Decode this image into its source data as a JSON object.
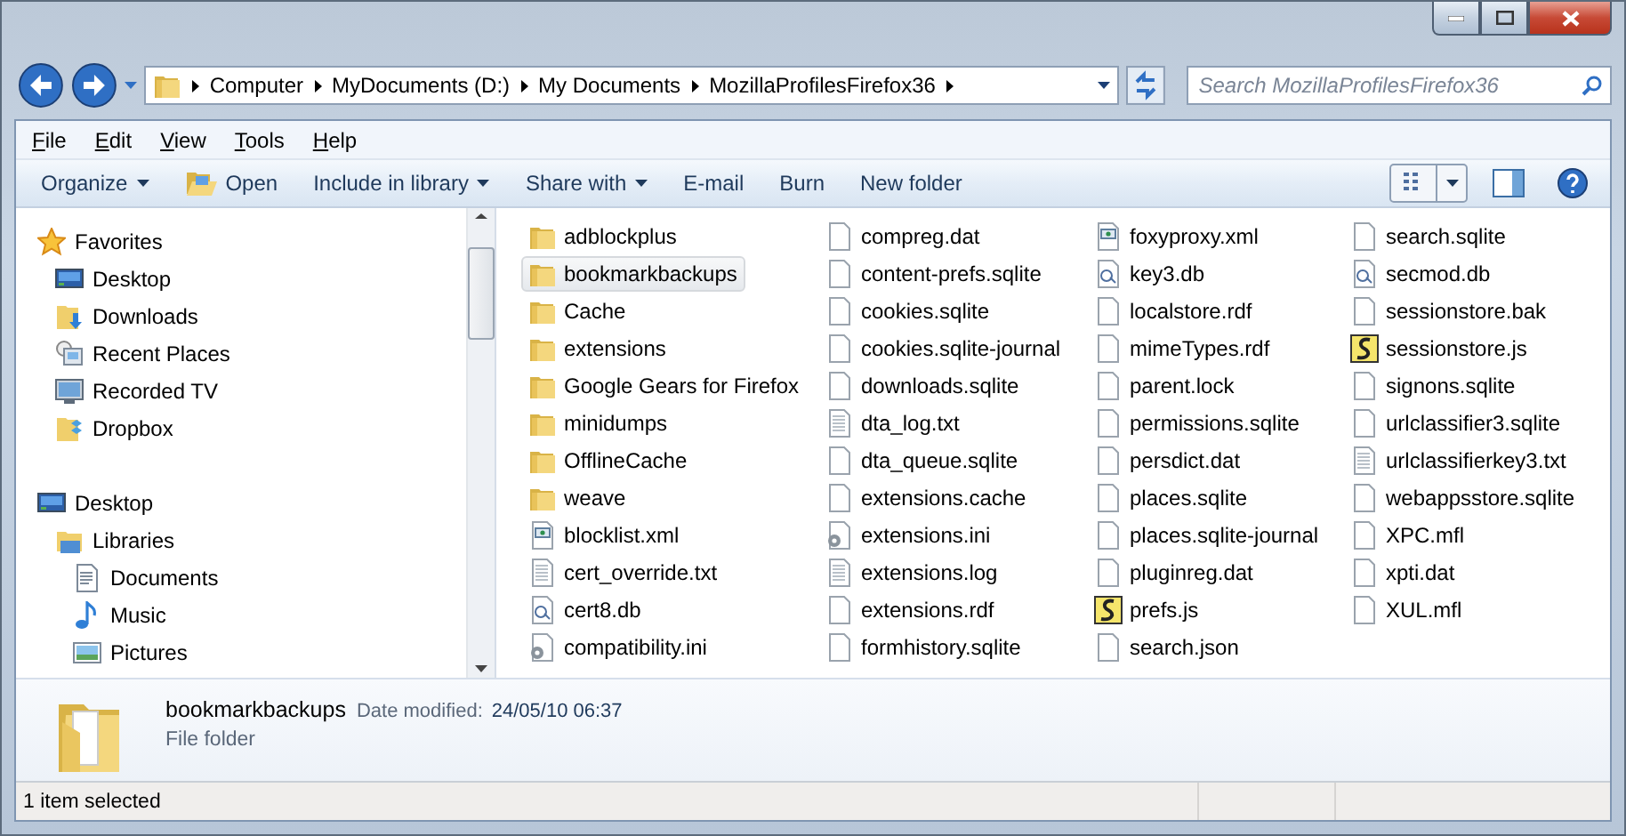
{
  "address": {
    "breadcrumbs": [
      "Computer",
      "MyDocuments (D:)",
      "My Documents",
      "MozillaProfilesFirefox36"
    ]
  },
  "search": {
    "placeholder": "Search MozillaProfilesFirefox36"
  },
  "menu": [
    "File",
    "Edit",
    "View",
    "Tools",
    "Help"
  ],
  "toolbar": [
    {
      "label": "Organize",
      "dropdown": true,
      "kind": "plain"
    },
    {
      "label": "Open",
      "dropdown": false,
      "kind": "open"
    },
    {
      "label": "Include in library",
      "dropdown": true,
      "kind": "plain"
    },
    {
      "label": "Share with",
      "dropdown": true,
      "kind": "plain"
    },
    {
      "label": "E-mail",
      "dropdown": false,
      "kind": "plain"
    },
    {
      "label": "Burn",
      "dropdown": false,
      "kind": "plain"
    },
    {
      "label": "New folder",
      "dropdown": false,
      "kind": "plain"
    }
  ],
  "sidebar": [
    {
      "label": "Favorites",
      "kind": "star",
      "children": [
        {
          "label": "Desktop",
          "kind": "desktop"
        },
        {
          "label": "Downloads",
          "kind": "downloads"
        },
        {
          "label": "Recent Places",
          "kind": "recent"
        },
        {
          "label": "Recorded TV",
          "kind": "tv"
        },
        {
          "label": "Dropbox",
          "kind": "dropbox"
        }
      ]
    },
    {
      "label": "Desktop",
      "kind": "desktop",
      "children": [
        {
          "label": "Libraries",
          "kind": "libraries",
          "children": [
            {
              "label": "Documents",
              "kind": "documents"
            },
            {
              "label": "Music",
              "kind": "music"
            },
            {
              "label": "Pictures",
              "kind": "pictures"
            }
          ]
        }
      ]
    }
  ],
  "files": [
    {
      "name": "adblockplus",
      "kind": "folder",
      "selected": false
    },
    {
      "name": "bookmarkbackups",
      "kind": "folder",
      "selected": true
    },
    {
      "name": "Cache",
      "kind": "folder",
      "selected": false
    },
    {
      "name": "extensions",
      "kind": "folder",
      "selected": false
    },
    {
      "name": "Google Gears for Firefox",
      "kind": "folder",
      "selected": false
    },
    {
      "name": "minidumps",
      "kind": "folder",
      "selected": false
    },
    {
      "name": "OfflineCache",
      "kind": "folder",
      "selected": false
    },
    {
      "name": "weave",
      "kind": "folder",
      "selected": false
    },
    {
      "name": "blocklist.xml",
      "kind": "xml",
      "selected": false
    },
    {
      "name": "cert_override.txt",
      "kind": "text",
      "selected": false
    },
    {
      "name": "cert8.db",
      "kind": "db",
      "selected": false
    },
    {
      "name": "compatibility.ini",
      "kind": "config",
      "selected": false
    },
    {
      "name": "compreg.dat",
      "kind": "file",
      "selected": false
    },
    {
      "name": "content-prefs.sqlite",
      "kind": "file",
      "selected": false
    },
    {
      "name": "cookies.sqlite",
      "kind": "file",
      "selected": false
    },
    {
      "name": "cookies.sqlite-journal",
      "kind": "file",
      "selected": false
    },
    {
      "name": "downloads.sqlite",
      "kind": "file",
      "selected": false
    },
    {
      "name": "dta_log.txt",
      "kind": "text",
      "selected": false
    },
    {
      "name": "dta_queue.sqlite",
      "kind": "file",
      "selected": false
    },
    {
      "name": "extensions.cache",
      "kind": "file",
      "selected": false
    },
    {
      "name": "extensions.ini",
      "kind": "config",
      "selected": false
    },
    {
      "name": "extensions.log",
      "kind": "text",
      "selected": false
    },
    {
      "name": "extensions.rdf",
      "kind": "file",
      "selected": false
    },
    {
      "name": "formhistory.sqlite",
      "kind": "file",
      "selected": false
    },
    {
      "name": "foxyproxy.xml",
      "kind": "xml",
      "selected": false
    },
    {
      "name": "key3.db",
      "kind": "db",
      "selected": false
    },
    {
      "name": "localstore.rdf",
      "kind": "file",
      "selected": false
    },
    {
      "name": "mimeTypes.rdf",
      "kind": "file",
      "selected": false
    },
    {
      "name": "parent.lock",
      "kind": "file",
      "selected": false
    },
    {
      "name": "permissions.sqlite",
      "kind": "file",
      "selected": false
    },
    {
      "name": "persdict.dat",
      "kind": "file",
      "selected": false
    },
    {
      "name": "places.sqlite",
      "kind": "file",
      "selected": false
    },
    {
      "name": "places.sqlite-journal",
      "kind": "file",
      "selected": false
    },
    {
      "name": "pluginreg.dat",
      "kind": "file",
      "selected": false
    },
    {
      "name": "prefs.js",
      "kind": "script",
      "selected": false
    },
    {
      "name": "search.json",
      "kind": "file",
      "selected": false
    },
    {
      "name": "search.sqlite",
      "kind": "file",
      "selected": false
    },
    {
      "name": "secmod.db",
      "kind": "db",
      "selected": false
    },
    {
      "name": "sessionstore.bak",
      "kind": "file",
      "selected": false
    },
    {
      "name": "sessionstore.js",
      "kind": "script",
      "selected": false
    },
    {
      "name": "signons.sqlite",
      "kind": "file",
      "selected": false
    },
    {
      "name": "urlclassifier3.sqlite",
      "kind": "file",
      "selected": false
    },
    {
      "name": "urlclassifierkey3.txt",
      "kind": "text",
      "selected": false
    },
    {
      "name": "webappsstore.sqlite",
      "kind": "file",
      "selected": false
    },
    {
      "name": "XPC.mfl",
      "kind": "file",
      "selected": false
    },
    {
      "name": "xpti.dat",
      "kind": "file",
      "selected": false
    },
    {
      "name": "XUL.mfl",
      "kind": "file",
      "selected": false
    }
  ],
  "details": {
    "name": "bookmarkbackups",
    "date_label": "Date modified:",
    "date": "24/05/10 06:37",
    "type": "File folder"
  },
  "status_bar": {
    "text": "1 item selected"
  }
}
